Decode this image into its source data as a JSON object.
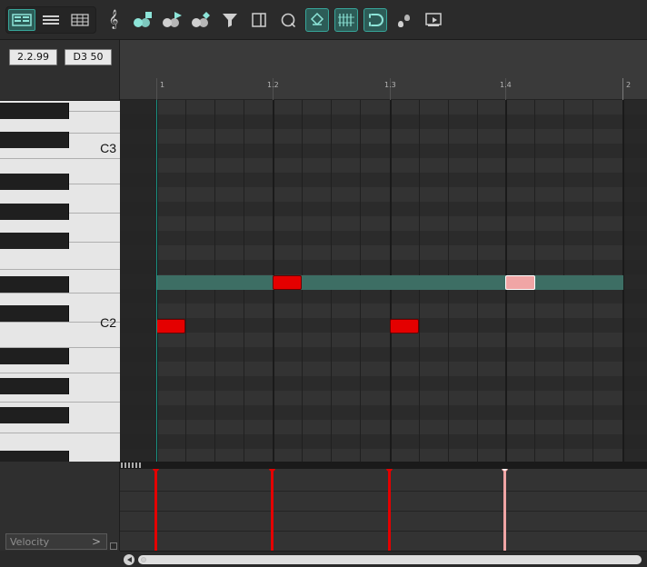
{
  "left_panel": {
    "position": "2.2.99",
    "note_value": "D3  50"
  },
  "ruler": {
    "labels": [
      "1",
      "1.2",
      "1.3",
      "1.4",
      "2"
    ]
  },
  "piano": {
    "octave_labels": {
      "c3": "C3",
      "c2": "C2"
    }
  },
  "lane": {
    "selector_label": "Velocity",
    "selector_chevron": ">"
  },
  "colors": {
    "accent": "#37a69a",
    "note": "#e40000",
    "note_selected": "#f0a5a5",
    "highlight_row": "#3d6e64"
  },
  "icons": {
    "toolbar": [
      "view-piano-roll-icon",
      "view-list-icon",
      "view-grid-icon",
      "treble-clef-icon",
      "tool-select-icon",
      "tool-play-icon",
      "tool-paint-icon",
      "filter-icon",
      "panel-icon",
      "quantize-icon",
      "link-icon",
      "grid-icon",
      "snap-icon",
      "footprint-icon",
      "audition-icon"
    ]
  }
}
